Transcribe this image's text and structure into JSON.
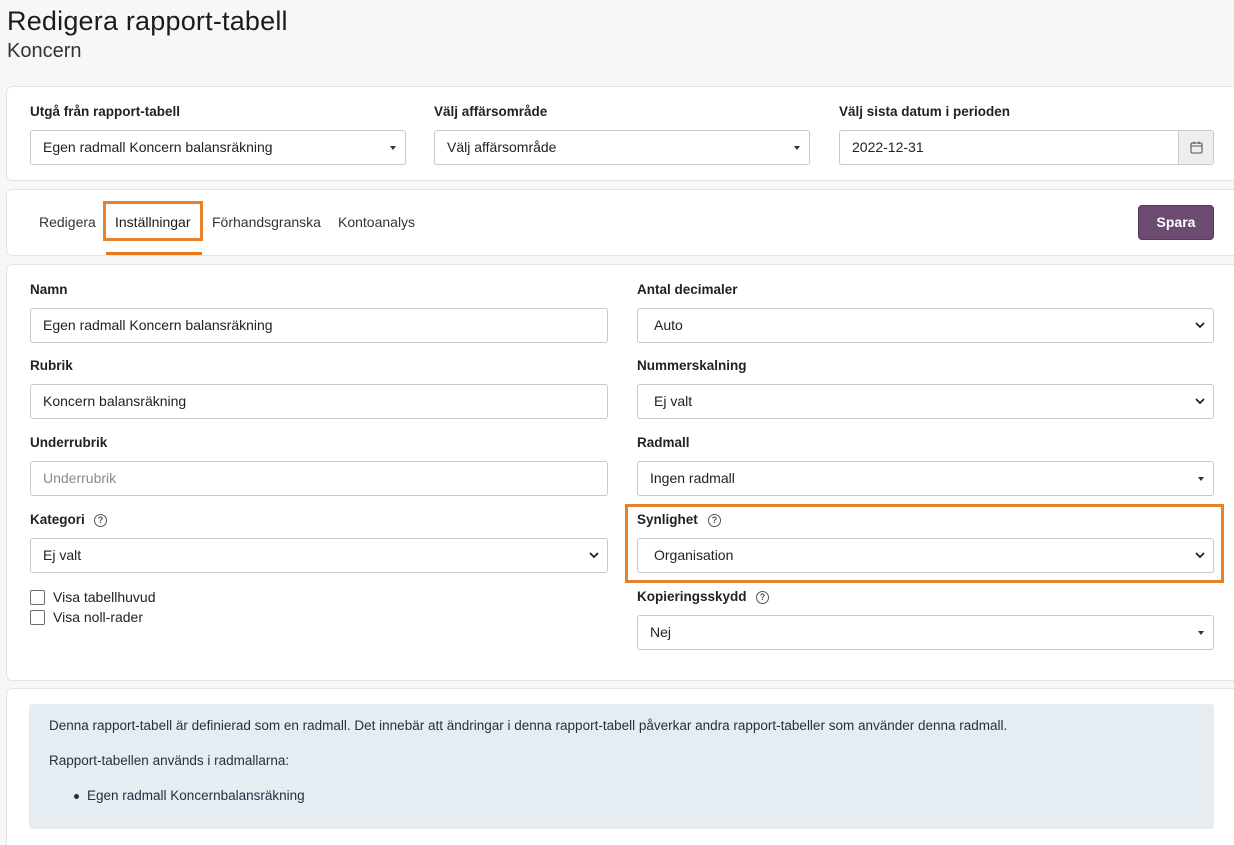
{
  "page": {
    "title": "Redigera rapport-tabell",
    "subtitle": "Koncern"
  },
  "top": {
    "source_label": "Utgå från rapport-tabell",
    "source_value": "Egen radmall Koncern balansräkning",
    "area_label": "Välj affärsområde",
    "area_value": "Välj affärsområde",
    "date_label": "Välj sista datum i perioden",
    "date_value": "2022-12-31"
  },
  "tabs": [
    {
      "label": "Redigera",
      "active": false
    },
    {
      "label": "Inställningar",
      "active": true
    },
    {
      "label": "Förhandsgranska",
      "active": false
    },
    {
      "label": "Kontoanalys",
      "active": false
    }
  ],
  "save_label": "Spara",
  "form": {
    "name_label": "Namn",
    "name_value": "Egen radmall Koncern balansräkning",
    "rubrik_label": "Rubrik",
    "rubrik_value": "Koncern balansräkning",
    "underrubrik_label": "Underrubrik",
    "underrubrik_placeholder": "Underrubrik",
    "kategori_label": "Kategori",
    "kategori_value": "Ej valt",
    "visa_tabellhuvud": "Visa tabellhuvud",
    "visa_noll_rader": "Visa noll-rader",
    "decimaler_label": "Antal decimaler",
    "decimaler_value": "Auto",
    "nummerskalning_label": "Nummerskalning",
    "nummerskalning_value": "Ej valt",
    "radmall_label": "Radmall",
    "radmall_value": "Ingen radmall",
    "synlighet_label": "Synlighet",
    "synlighet_value": "Organisation",
    "kopieringsskydd_label": "Kopieringsskydd",
    "kopieringsskydd_value": "Nej",
    "help_glyph": "?"
  },
  "info": {
    "line1": "Denna rapport-tabell är definierad som en radmall. Det innebär att ändringar i denna rapport-tabell påverkar andra rapport-tabeller som använder denna radmall.",
    "line2": "Rapport-tabellen används i radmallarna:",
    "items": [
      "Egen radmall Koncernbalansräkning"
    ]
  },
  "colors": {
    "accent": "#e87722",
    "save_button": "#6d4a6f",
    "info_bg": "#e5edf3"
  }
}
